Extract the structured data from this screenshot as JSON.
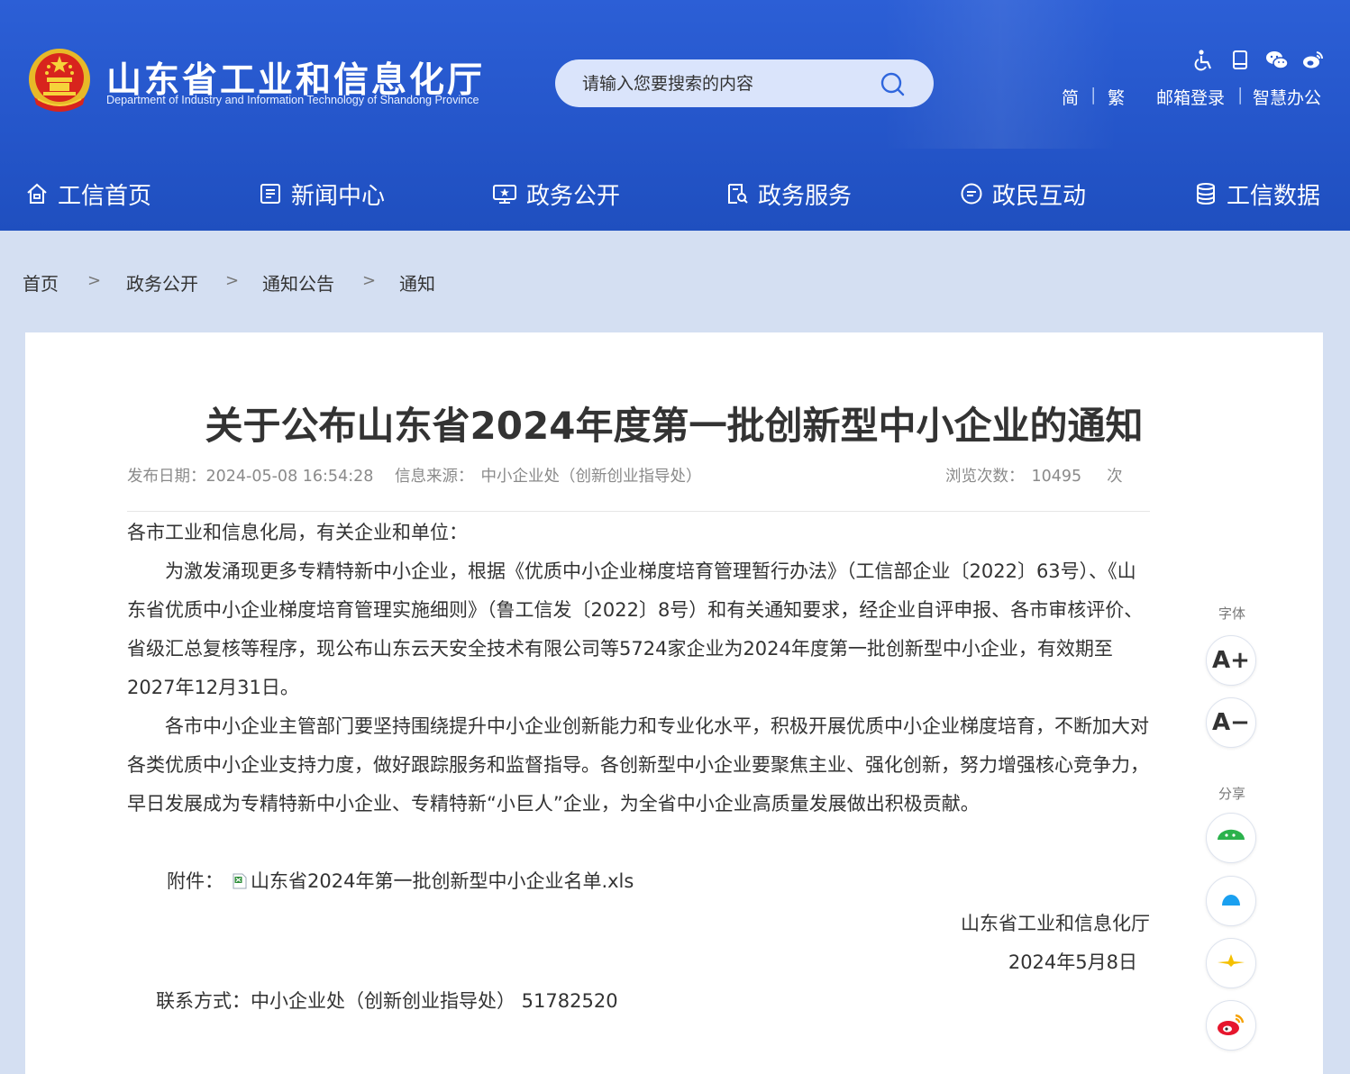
{
  "header": {
    "site_name": "山东省工业和信息化厅",
    "site_subtitle": "Department of Industry and Information Technology of Shandong Province",
    "search_placeholder": "请输入您要搜索的内容",
    "top_icons": [
      "accessibility-icon",
      "mobile-icon",
      "wechat-icon",
      "weibo-icon"
    ],
    "links": {
      "simplified": "简",
      "sep1": "|",
      "traditional": "繁",
      "mail": "邮箱登录",
      "sep2": "|",
      "office": "智慧办公"
    }
  },
  "nav": {
    "items": [
      {
        "label": "工信首页",
        "icon": "home-icon"
      },
      {
        "label": "新闻中心",
        "icon": "news-icon"
      },
      {
        "label": "政务公开",
        "icon": "gov-open-icon"
      },
      {
        "label": "政务服务",
        "icon": "gov-service-icon"
      },
      {
        "label": "政民互动",
        "icon": "interaction-icon"
      },
      {
        "label": "工信数据",
        "icon": "database-icon"
      }
    ]
  },
  "breadcrumb": {
    "items": [
      "首页",
      "政务公开",
      "通知公告",
      "通知"
    ],
    "separator": ">"
  },
  "article": {
    "title": "关于公布山东省2024年度第一批创新型中小企业的通知",
    "publish_label": "发布日期：",
    "publish_date": "2024-05-08 16:54:28",
    "source_label": "信息来源：",
    "source": "中小企业处（创新创业指导处）",
    "views_label": "浏览次数：",
    "views": "10495",
    "views_unit": "次",
    "salutation": "各市工业和信息化局，有关企业和单位：",
    "paragraph1": "为激发涌现更多专精特新中小企业，根据《优质中小企业梯度培育管理暂行办法》（工信部企业〔2022〕63号）、《山东省优质中小企业梯度培育管理实施细则》（鲁工信发〔2022〕8号）和有关通知要求，经企业自评申报、各市审核评价、省级汇总复核等程序，现公布山东云天安全技术有限公司等5724家企业为2024年度第一批创新型中小企业，有效期至2027年12月31日。",
    "paragraph2": "各市中小企业主管部门要坚持围绕提升中小企业创新能力和专业化水平，积极开展优质中小企业梯度培育，不断加大对各类优质中小企业支持力度，做好跟踪服务和监督指导。各创新型中小企业要聚焦主业、强化创新，努力增强核心竞争力，早日发展成为专精特新中小企业、专精特新“小巨人”企业，为全省中小企业高质量发展做出积极贡献。",
    "attachment_label": "附件：",
    "attachment_name": "山东省2024年第一批创新型中小企业名单.xls",
    "signature_org": "山东省工业和信息化厅",
    "signature_date": "2024年5月8日",
    "contact": "联系方式：中小企业处（创新创业指导处） 51782520"
  },
  "sidebar": {
    "font_label": "字体",
    "font_increase": "A+",
    "font_decrease": "A−",
    "share_label": "分享",
    "share_icons": [
      "wechat-share-icon",
      "qq-share-icon",
      "qzone-share-icon",
      "weibo-share-icon"
    ]
  },
  "colors": {
    "header_blue": "#2455c9",
    "page_bg": "#d4dff2",
    "wechat_green": "#2bb24c",
    "qq_blue": "#1aa0f0",
    "qzone_yellow": "#f5c000",
    "weibo_red": "#e6162d"
  }
}
